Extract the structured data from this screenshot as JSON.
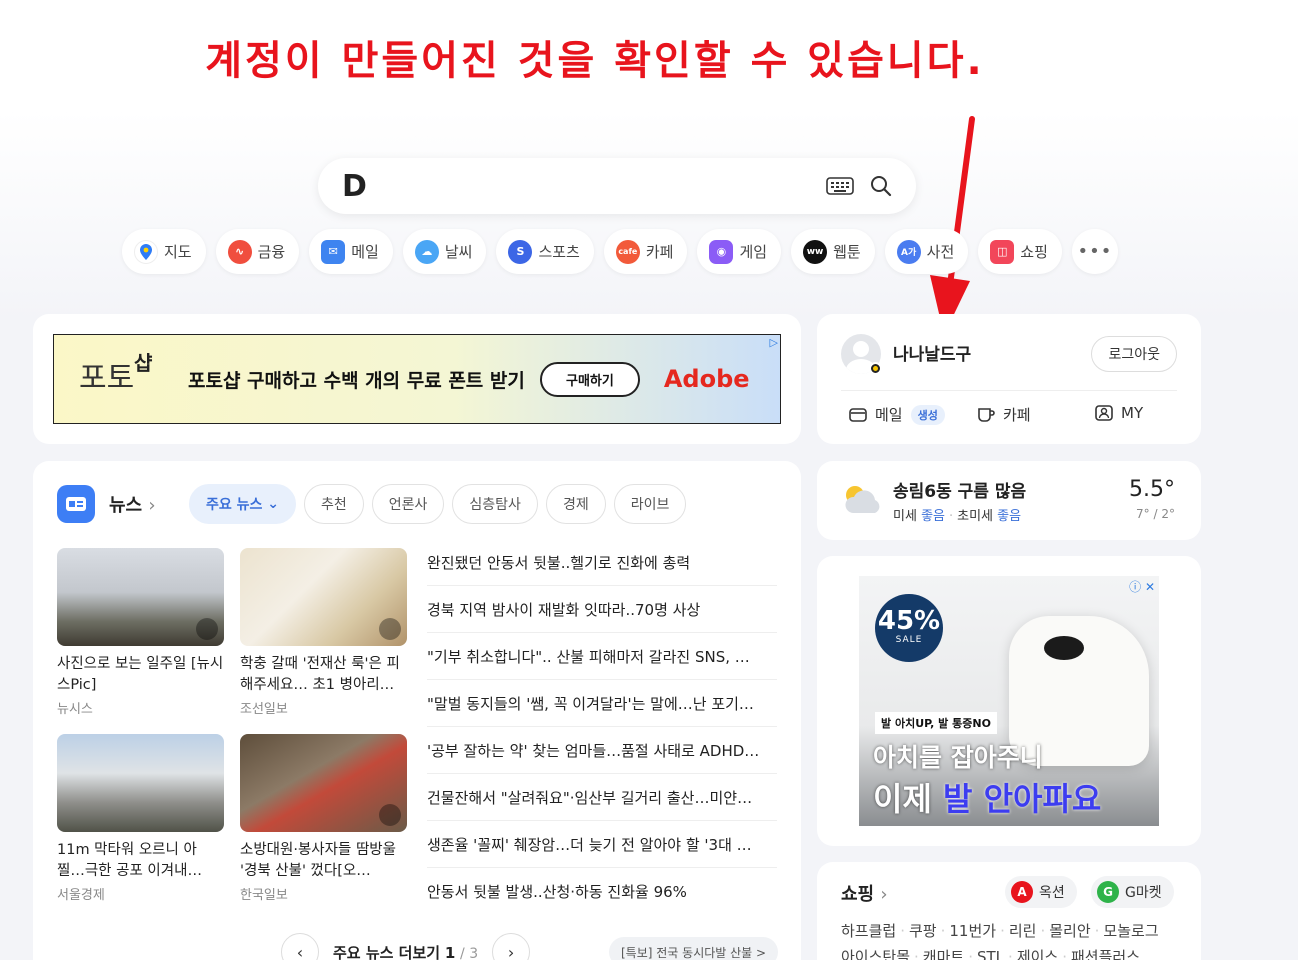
{
  "annotation": "계정이 만들어진 것을 확인할 수 있습니다.",
  "search": {
    "logo": "D"
  },
  "shortcuts": [
    {
      "label": "지도",
      "icon": "map-pin-icon",
      "color": "#ffffff"
    },
    {
      "label": "금융",
      "icon": "chart-line-icon",
      "color": "#f04e3e"
    },
    {
      "label": "메일",
      "icon": "mail-icon",
      "color": "#3e84f0"
    },
    {
      "label": "날씨",
      "icon": "weather-icon",
      "color": "#4aa6f5"
    },
    {
      "label": "스포츠",
      "icon": "sports-icon",
      "color": "#3c66e6"
    },
    {
      "label": "카페",
      "icon": "cafe-icon",
      "color": "#f25a3a"
    },
    {
      "label": "게임",
      "icon": "game-icon",
      "color": "#8b5cf6"
    },
    {
      "label": "웹툰",
      "icon": "webtoon-icon",
      "color": "#111111"
    },
    {
      "label": "사전",
      "icon": "dictionary-icon",
      "color": "#4a7cf0"
    },
    {
      "label": "쇼핑",
      "icon": "shopping-icon",
      "color": "#f2465a"
    }
  ],
  "more_label": "•••",
  "ad_top": {
    "logo_char1": "포토",
    "logo_char2": "샵",
    "text": "포토샵 구매하고 수백 개의 무료 폰트 받기",
    "button": "구매하기",
    "brand": "Adobe",
    "mark": "▷"
  },
  "news": {
    "title": "뉴스",
    "tabs": [
      "주요 뉴스",
      "추천",
      "언론사",
      "심층탐사",
      "경제",
      "라이브"
    ],
    "thumbs": [
      {
        "caption": "사진으로 보는 일주일 [뉴시스Pic]",
        "source": "뉴시스"
      },
      {
        "caption": "학충 갈때 '전재산 룩'은 피해주세요… 초1 병아리…",
        "source": "조선일보"
      },
      {
        "caption": "11m 막타워 오르니 아찔…극한 공포 이겨내…",
        "source": "서울경제"
      },
      {
        "caption": "소방대원·봉사자들 땀방울 '경북 산불' 껐다[오…",
        "source": "한국일보"
      }
    ],
    "headlines": [
      "완진됐던 안동서 뒷불..헬기로 진화에 총력",
      "경북 지역 밤사이 재발화 잇따라..70명 사상",
      "\"기부 취소합니다\".. 산불 피해마저 갈라진 SNS, …",
      "\"말벌 동지들의 '쌤, 꼭 이겨달라'는 말에…난 포기…",
      "'공부 잘하는 약' 찾는 엄마들…품절 사태로 ADHD…",
      "건물잔해서 \"살려줘요\"·임산부 길거리 출산…미얀…",
      "생존율 '꼴찌' 췌장암…더 늦기 전 알아야 할 '3대 …",
      "안동서 뒷불 발생..산청·하동 진화율 96%"
    ],
    "pager_label": "주요 뉴스 더보기",
    "page_current": "1",
    "page_total": "/ 3",
    "special": "[특보] 전국 동시다발 산불 >"
  },
  "login": {
    "username": "나나날드구",
    "logout": "로그아웃",
    "mail": "메일",
    "mail_badge": "생성",
    "cafe": "카페",
    "my": "MY"
  },
  "weather": {
    "location": "송림6동 구름 많음",
    "fine_dust_label": "미세",
    "fine_dust_value": "좋음",
    "ultra_dust_label": "초미세",
    "ultra_dust_value": "좋음",
    "temp": "5.5°",
    "range": "7° / 2°"
  },
  "ad_side": {
    "sale_pct": "45%",
    "sale_label": "SALE",
    "tag": "발 아치UP, 발 통증NO",
    "line1": "아치를 잡아주니",
    "line2_a": "이제",
    "line2_b": "발 안아파요",
    "marks": "ⓘ ✕"
  },
  "shopping": {
    "title": "쇼핑",
    "malls": [
      {
        "label": "옥션",
        "mark": "A",
        "color": "#e8141d"
      },
      {
        "label": "G마켓",
        "mark": "G",
        "color": "#2fb34a"
      }
    ],
    "links_line1": [
      "하프클럽",
      "쿠팡",
      "11번가",
      "리린",
      "몰리안",
      "모놀로그"
    ],
    "links_line2": [
      "아이스탄몰",
      "캐마트",
      "STL",
      "제이스",
      "패션플러스"
    ]
  }
}
